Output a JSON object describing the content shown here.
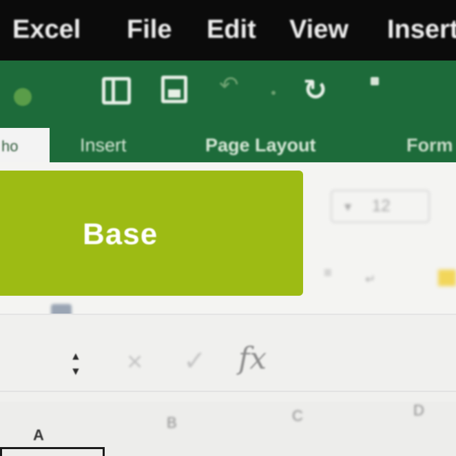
{
  "menubar": {
    "app_name": "Excel",
    "items": [
      "File",
      "Edit",
      "View",
      "Insert"
    ]
  },
  "quick_access": {
    "icons": [
      "sidebar-icon",
      "save-icon",
      "undo-icon",
      "redo-icon"
    ]
  },
  "ribbon": {
    "tabs": {
      "home_partial": "ho",
      "insert": "Insert",
      "page_layout": "Page Layout",
      "formulas_partial": "Form"
    },
    "font_size": "12"
  },
  "overlay": {
    "label": "Base",
    "color": "#9dbb14"
  },
  "formula_bar": {
    "fx_label": "fx"
  },
  "columns": {
    "headers": [
      "A",
      "B",
      "C",
      "D"
    ]
  },
  "colors": {
    "menubar_bg": "#0b0b0b",
    "titlebar_green": "#1d6b3a"
  }
}
